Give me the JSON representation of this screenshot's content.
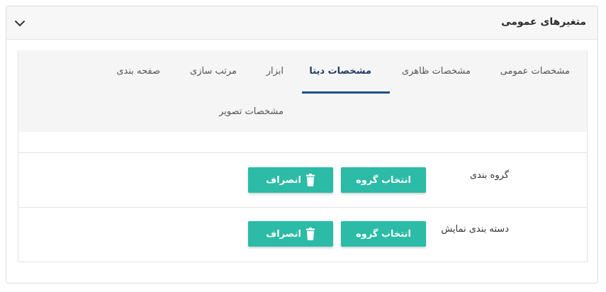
{
  "panel": {
    "title": "متغیرهای عمومی",
    "collapse_icon": "chevron-down-icon"
  },
  "tabs": [
    {
      "id": "general",
      "label": "مشخصات عمومی",
      "active": false
    },
    {
      "id": "appearance",
      "label": "مشخصات ظاهری",
      "active": false
    },
    {
      "id": "data",
      "label": "مشخصات دیتا",
      "active": true
    },
    {
      "id": "tools",
      "label": "ابزار",
      "active": false
    },
    {
      "id": "sorting",
      "label": "مرتب سازی",
      "active": false
    },
    {
      "id": "paging",
      "label": "صفحه بندی",
      "active": false
    },
    {
      "id": "image",
      "label": "مشخصات تصویر",
      "active": false
    }
  ],
  "rows": [
    {
      "label": "گروه بندی",
      "select_label": "انتخاب گروه",
      "cancel_label": "انصراف"
    },
    {
      "label": "دسته بندی نمایش",
      "select_label": "انتخاب گروه",
      "cancel_label": "انصراف"
    }
  ],
  "colors": {
    "accent": "#2bbba7",
    "active_tab": "#1f4e8c"
  }
}
